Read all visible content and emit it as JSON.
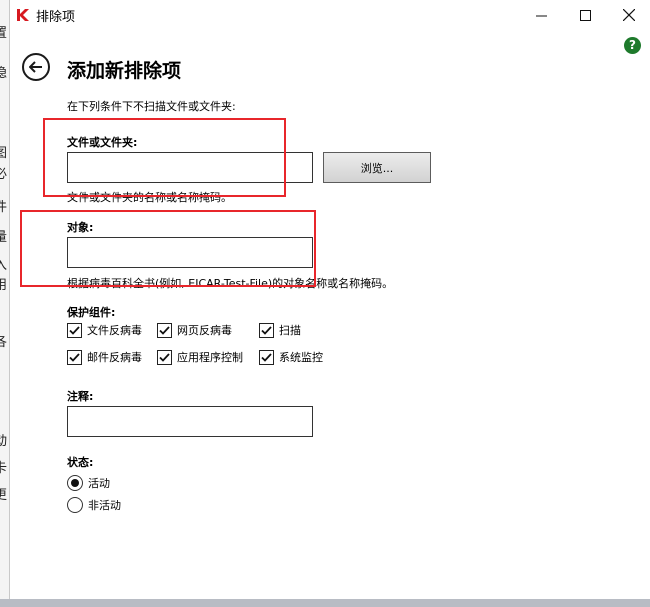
{
  "window": {
    "title": "排除项"
  },
  "background_strip": [
    "[",
    "置",
    "隐",
    "图",
    "必",
    "件",
    "量",
    "入",
    "用",
    "各",
    "动",
    "卡",
    "更"
  ],
  "header": {
    "title": "添加新排除项",
    "help_symbol": "?"
  },
  "form": {
    "intro": "在下列条件下不扫描文件或文件夹:",
    "file": {
      "label": "文件或文件夹:",
      "value": "",
      "browse_label": "浏览...",
      "hint": "文件或文件夹的名称或名称掩码。"
    },
    "object": {
      "label": "对象:",
      "value": "",
      "hint": "根据病毒百科全书(例如, EICAR-Test-File)的对象名称或名称掩码。"
    },
    "components": {
      "label": "保护组件:",
      "items": [
        {
          "label": "文件反病毒",
          "checked": true
        },
        {
          "label": "网页反病毒",
          "checked": true
        },
        {
          "label": "扫描",
          "checked": true
        },
        {
          "label": "邮件反病毒",
          "checked": true
        },
        {
          "label": "应用程序控制",
          "checked": true
        },
        {
          "label": "系统监控",
          "checked": true
        }
      ]
    },
    "comment": {
      "label": "注释:",
      "value": ""
    },
    "status": {
      "label": "状态:",
      "options": [
        {
          "label": "活动",
          "selected": true
        },
        {
          "label": "非活动",
          "selected": false
        }
      ]
    }
  },
  "colors": {
    "highlight": "#e8262b",
    "help_icon": "#1e7a2c",
    "brand": "#d71920"
  }
}
